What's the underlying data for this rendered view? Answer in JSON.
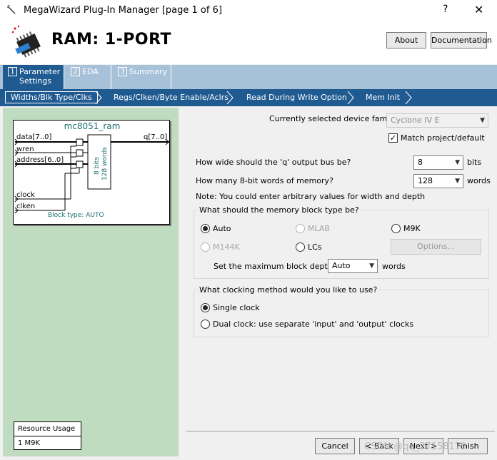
{
  "window": {
    "title": "MegaWizard Plug-In Manager [page 1 of 6]",
    "help_glyph": "?",
    "close_glyph": "✕"
  },
  "header": {
    "title": "RAM: 1-PORT",
    "about_label": "About",
    "documentation_label": "Documentation"
  },
  "tabs": [
    {
      "num": "1",
      "label": "Parameter Settings",
      "active": true
    },
    {
      "num": "2",
      "label": "EDA",
      "active": false
    },
    {
      "num": "3",
      "label": "Summary",
      "active": false
    }
  ],
  "steps": [
    {
      "label": "Widths/Blk Type/Clks",
      "active": true
    },
    {
      "label": "Regs/Clken/Byte Enable/Aclrs",
      "active": false
    },
    {
      "label": "Read During Write Option",
      "active": false
    },
    {
      "label": "Mem Init",
      "active": false
    }
  ],
  "symbol": {
    "name": "mc8051_ram",
    "ports_in": [
      "data[7..0]",
      "wren",
      "address[6..0]",
      "clock",
      "clken"
    ],
    "port_out": "q[7..0]",
    "mem_line1": "8 bits",
    "mem_line2": "128 words",
    "block_type": "Block type: AUTO"
  },
  "resource": {
    "header": "Resource Usage",
    "value": "1 M9K"
  },
  "device": {
    "label": "Currently selected device family:",
    "value": "Cyclone IV E",
    "match_label": "Match project/default",
    "match_checked": true
  },
  "width": {
    "label": "How wide should the 'q' output bus be?",
    "value": "8",
    "unit": "bits"
  },
  "depth": {
    "label": "How many 8-bit words of memory?",
    "value": "128",
    "unit": "words"
  },
  "note": "Note: You could enter arbitrary values for width and depth",
  "block_type": {
    "title": "What should the memory block type be?",
    "options": [
      "Auto",
      "MLAB",
      "M9K",
      "M144K",
      "LCs"
    ],
    "selected": "Auto",
    "options_button": "Options...",
    "max_depth_label": "Set the maximum block depth to",
    "max_depth_value": "Auto",
    "max_depth_unit": "words"
  },
  "clocking": {
    "title": "What clocking method would you like to use?",
    "options": [
      "Single clock",
      "Dual clock: use separate 'input' and 'output' clocks"
    ],
    "selected": "Single clock"
  },
  "buttons": {
    "cancel": "Cancel",
    "back": "< Back",
    "next": "Next >",
    "finish": "Finish"
  },
  "watermark": "CSDN @qq_27158179",
  "colors": {
    "tab_active": "#1f5a90",
    "tab_inactive": "#a7c1d9",
    "left_panel": "#c0dcc0",
    "symbol_text": "#1a7070"
  }
}
